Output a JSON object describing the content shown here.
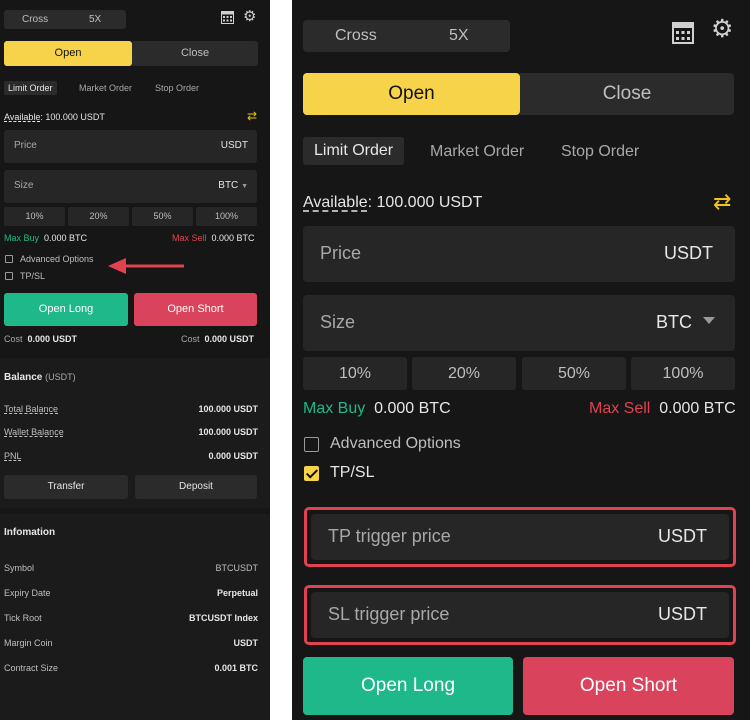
{
  "colors": {
    "accent": "#f7d34a",
    "long": "#1fb88a",
    "short": "#d9435b",
    "highlight": "#e0434f",
    "bg": "#161616"
  },
  "left": {
    "margin_mode": "Cross",
    "leverage": "5X",
    "icons": {
      "calculator": "calculator-icon",
      "settings": "gear-icon",
      "swap": "swap-icon"
    },
    "open_label": "Open",
    "close_label": "Close",
    "order_tabs": [
      "Limit Order",
      "Market Order",
      "Stop Order"
    ],
    "available_label": "Available",
    "available_value": ": 100.000 USDT",
    "price_placeholder": "Price",
    "price_unit": "USDT",
    "size_placeholder": "Size",
    "size_unit": "BTC",
    "percentages": [
      "10%",
      "20%",
      "50%",
      "100%"
    ],
    "max_buy_label": "Max Buy",
    "max_buy_value": "0.000 BTC",
    "max_sell_label": "Max Sell",
    "max_sell_value": "0.000 BTC",
    "advanced_options": "Advanced Options",
    "tpsl": "TP/SL",
    "open_long": "Open Long",
    "open_short": "Open Short",
    "cost_label": "Cost",
    "cost_long": "0.000 USDT",
    "cost_short": "0.000 USDT",
    "balance": {
      "title": "Balance",
      "unit": "(USDT)",
      "rows": [
        {
          "label": "Total Balance",
          "value": "100.000 USDT"
        },
        {
          "label": "Wallet Balance",
          "value": "100.000 USDT"
        },
        {
          "label": "PNL",
          "value": "0.000 USDT"
        }
      ],
      "transfer": "Transfer",
      "deposit": "Deposit"
    },
    "info": {
      "title": "Infomation",
      "rows": [
        {
          "label": "Symbol",
          "value": "BTCUSDT"
        },
        {
          "label": "Expiry Date",
          "value": "Perpetual"
        },
        {
          "label": "Tick Root",
          "value": "BTCUSDT Index"
        },
        {
          "label": "Margin Coin",
          "value": "USDT"
        },
        {
          "label": "Contract Size",
          "value": "0.001 BTC"
        }
      ]
    }
  },
  "right": {
    "margin_mode": "Cross",
    "leverage": "5X",
    "open_label": "Open",
    "close_label": "Close",
    "order_tabs": [
      "Limit Order",
      "Market Order",
      "Stop Order"
    ],
    "available_label": "Available",
    "available_value": ": 100.000 USDT",
    "price_placeholder": "Price",
    "price_unit": "USDT",
    "size_placeholder": "Size",
    "size_unit": "BTC",
    "percentages": [
      "10%",
      "20%",
      "50%",
      "100%"
    ],
    "max_buy_label": "Max Buy",
    "max_buy_value": "0.000 BTC",
    "max_sell_label": "Max Sell",
    "max_sell_value": "0.000 BTC",
    "advanced_options": "Advanced Options",
    "tpsl": "TP/SL",
    "tp_placeholder": "TP trigger price",
    "tp_unit": "USDT",
    "sl_placeholder": "SL trigger price",
    "sl_unit": "USDT",
    "open_long": "Open Long",
    "open_short": "Open Short"
  }
}
